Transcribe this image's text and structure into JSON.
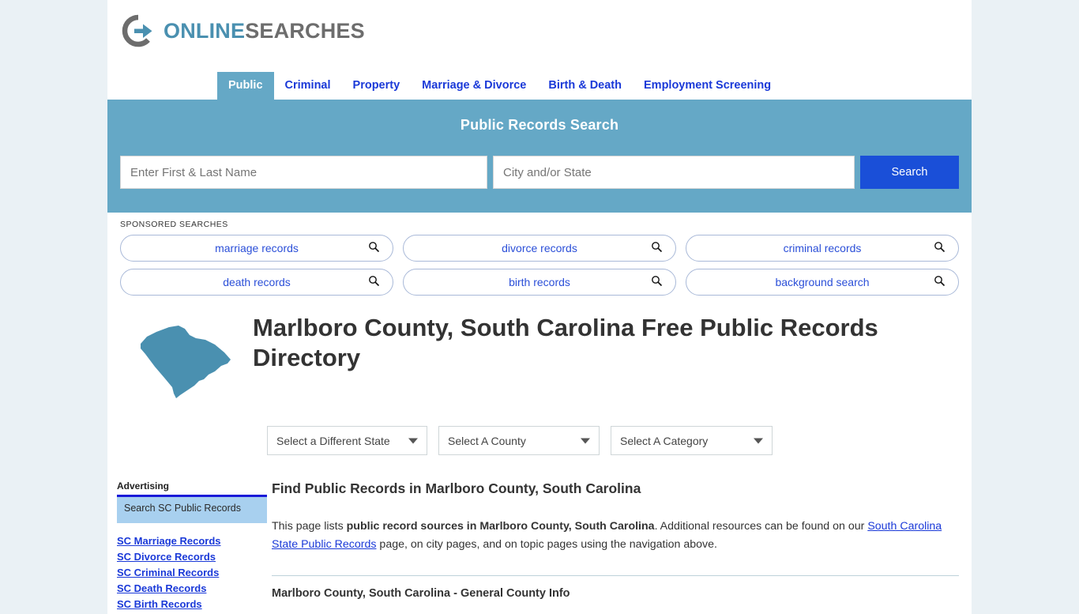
{
  "site": {
    "logo_primary": "ONLINE",
    "logo_secondary": "SEARCHES",
    "brand_blue": "#4a90b0",
    "brand_gray": "#6d6d6d"
  },
  "nav": {
    "tabs": [
      {
        "label": "Public",
        "active": true
      },
      {
        "label": "Criminal",
        "active": false
      },
      {
        "label": "Property",
        "active": false
      },
      {
        "label": "Marriage & Divorce",
        "active": false
      },
      {
        "label": "Birth & Death",
        "active": false
      },
      {
        "label": "Employment Screening",
        "active": false
      }
    ]
  },
  "search_banner": {
    "title": "Public Records Search",
    "name_placeholder": "Enter First & Last Name",
    "name_value": "",
    "city_placeholder": "City and/or State",
    "city_value": "",
    "search_button": "Search",
    "background_color": "#65a8c6",
    "button_color": "#1a4fd8"
  },
  "sponsored": {
    "label": "SPONSORED SEARCHES",
    "items": [
      "marriage records",
      "divorce records",
      "criminal records",
      "death records",
      "birth records",
      "background search"
    ]
  },
  "hero": {
    "state_icon": "south-carolina-map",
    "state_color": "#4a90b0",
    "title": "Marlboro County, South Carolina Free Public Records Directory"
  },
  "filters": {
    "state_select": "Select a Different State",
    "county_select": "Select A County",
    "category_select": "Select A Category"
  },
  "sidebar": {
    "advertising_label": "Advertising",
    "ad_box_text": "Search SC Public Records",
    "links": [
      "SC Marriage Records",
      "SC Divorce Records",
      "SC Criminal Records",
      "SC Death Records",
      "SC Birth Records"
    ]
  },
  "main": {
    "section_heading": "Find Public Records in Marlboro County, South Carolina",
    "paragraph_part1": "This page lists ",
    "paragraph_bold": "public record sources in Marlboro County, South Carolina",
    "paragraph_part2": ". Additional resources can be found on our ",
    "paragraph_link": "South Carolina State Public Records",
    "paragraph_part3": " page, on city pages, and on topic pages using the navigation above.",
    "subsection_heading": "Marlboro County, South Carolina - General County Info"
  }
}
